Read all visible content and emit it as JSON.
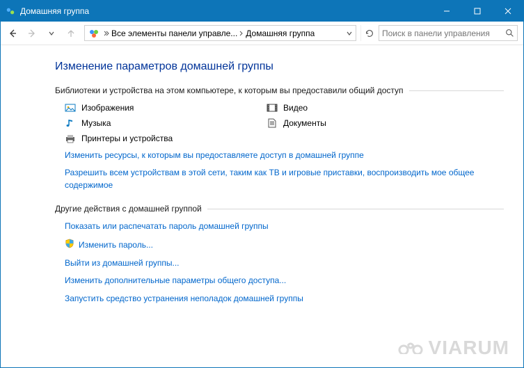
{
  "window": {
    "title": "Домашняя группа"
  },
  "toolbar": {
    "breadcrumb": {
      "root_label": "Все элементы панели управле...",
      "current_label": "Домашняя группа"
    },
    "search": {
      "placeholder": "Поиск в панели управления"
    }
  },
  "page": {
    "title": "Изменение параметров домашней группы",
    "section1_label": "Библиотеки и устройства на этом компьютере, к которым вы предоставили общий доступ",
    "libs": {
      "images": "Изображения",
      "video": "Видео",
      "music": "Музыка",
      "documents": "Документы",
      "printers": "Принтеры и устройства"
    },
    "links1": {
      "change_shared": "Изменить ресурсы, к которым вы предоставляете доступ в домашней группе",
      "allow_devices": "Разрешить всем устройствам в этой сети, таким как ТВ и игровые приставки, воспроизводить мое общее содержимое"
    },
    "section2_label": "Другие действия с домашней группой",
    "links2": {
      "show_password": "Показать или распечатать пароль домашней группы",
      "change_password": "Изменить пароль...",
      "leave": "Выйти из домашней группы...",
      "advanced": "Изменить дополнительные параметры общего доступа...",
      "troubleshoot": "Запустить средство устранения неполадок домашней группы"
    }
  },
  "watermark": {
    "text": "VIARUM"
  }
}
